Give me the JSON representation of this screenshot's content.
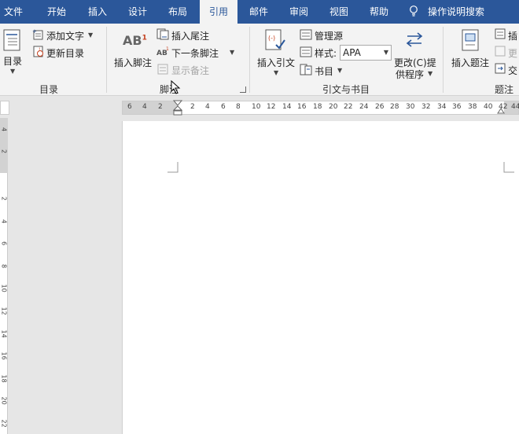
{
  "tabs": [
    {
      "label": "文件",
      "active": false
    },
    {
      "label": "开始",
      "active": false
    },
    {
      "label": "插入",
      "active": false
    },
    {
      "label": "设计",
      "active": false
    },
    {
      "label": "布局",
      "active": false
    },
    {
      "label": "引用",
      "active": true
    },
    {
      "label": "邮件",
      "active": false
    },
    {
      "label": "审阅",
      "active": false
    },
    {
      "label": "视图",
      "active": false
    },
    {
      "label": "帮助",
      "active": false
    }
  ],
  "tell_me": "操作说明搜索",
  "ribbon": {
    "toc": {
      "toc_button": "目录",
      "add_text": "添加文字",
      "update_table": "更新目录",
      "group_label": "目录"
    },
    "footnotes": {
      "insert_footnote": "插入脚注",
      "insert_endnote": "插入尾注",
      "next_footnote": "下一条脚注",
      "show_notes": "显示备注",
      "group_label": "脚注",
      "ab_glyph": "AB",
      "sup_glyph": "1"
    },
    "citations": {
      "insert_citation": "插入引文",
      "manage_sources": "管理源",
      "style_label": "样式:",
      "style_value": "APA",
      "bibliography": "书目",
      "update_tools_line1": "更改(C)提",
      "update_tools_line2": "供程序",
      "group_label": "引文与书目"
    },
    "captions": {
      "insert_caption": "插入题注",
      "insert_table_of_figures": "插",
      "update_table": "更",
      "cross_reference": "交",
      "group_label": "题注"
    }
  },
  "ruler": {
    "h_numbers": [
      "6",
      "4",
      "2",
      "2",
      "4",
      "6",
      "8",
      "10",
      "12",
      "14",
      "16",
      "18",
      "20",
      "22",
      "24",
      "26",
      "28",
      "30",
      "32",
      "34",
      "36",
      "38",
      "40",
      "42",
      "44"
    ],
    "v_numbers": [
      "4",
      "2",
      "2",
      "4",
      "6",
      "8",
      "10",
      "12",
      "14",
      "16",
      "18",
      "20",
      "22"
    ]
  },
  "colors": {
    "tab_bar": "#2b579a",
    "ribbon_bg": "#f3f3f3",
    "doc_bg": "#e6e6e6"
  }
}
